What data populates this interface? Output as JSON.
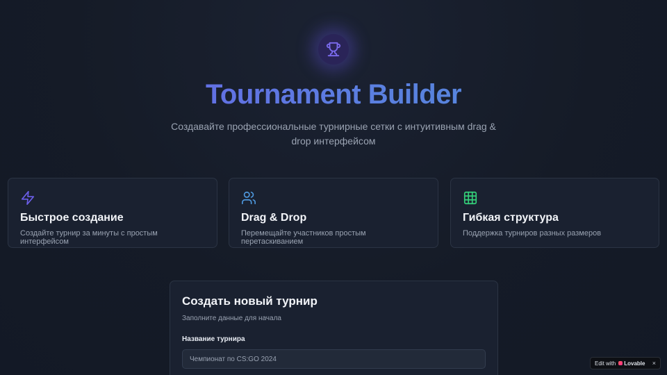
{
  "hero": {
    "logo_icon": "trophy-icon",
    "title": "Tournament Builder",
    "subtitle": "Создавайте профессиональные турнирные сетки с интуитивным drag & drop интерфейсом"
  },
  "features": [
    {
      "icon": "zap-icon",
      "icon_color": "#6b5ee8",
      "title": "Быстрое создание",
      "description": "Создайте турнир за минуты с простым интерфейсом"
    },
    {
      "icon": "users-icon",
      "icon_color": "#4f9ae0",
      "title": "Drag & Drop",
      "description": "Перемещайте участников простым перетаскиванием"
    },
    {
      "icon": "grid-icon",
      "icon_color": "#34d17a",
      "title": "Гибкая структура",
      "description": "Поддержка турниров разных размеров"
    }
  ],
  "form": {
    "title": "Создать новый турнир",
    "subtitle": "Заполните данные для начала",
    "name_label": "Название турнира",
    "name_placeholder": "Чемпионат по CS:GO 2024"
  },
  "badge": {
    "prefix": "Edit with",
    "brand": "Lovable",
    "close": "×"
  },
  "colors": {
    "background": "#141a26",
    "accent_start": "#6a5ee8",
    "accent_end": "#4f8fd8"
  }
}
